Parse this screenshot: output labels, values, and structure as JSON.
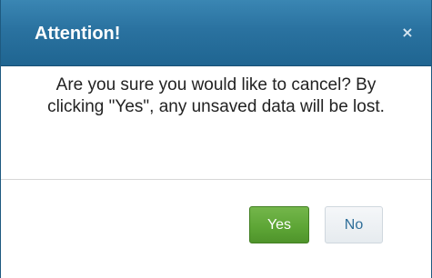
{
  "dialog": {
    "title": "Attention!",
    "close_icon": "×",
    "message": "Are you sure you would like to cancel? By clicking \"Yes\", any unsaved data will be lost.",
    "buttons": {
      "yes_label": "Yes",
      "no_label": "No"
    }
  },
  "colors": {
    "titlebar": "#2a72a0",
    "yes_button": "#5ea636",
    "no_button_text": "#2e6e99"
  },
  "icons": {
    "close": "close-icon"
  }
}
